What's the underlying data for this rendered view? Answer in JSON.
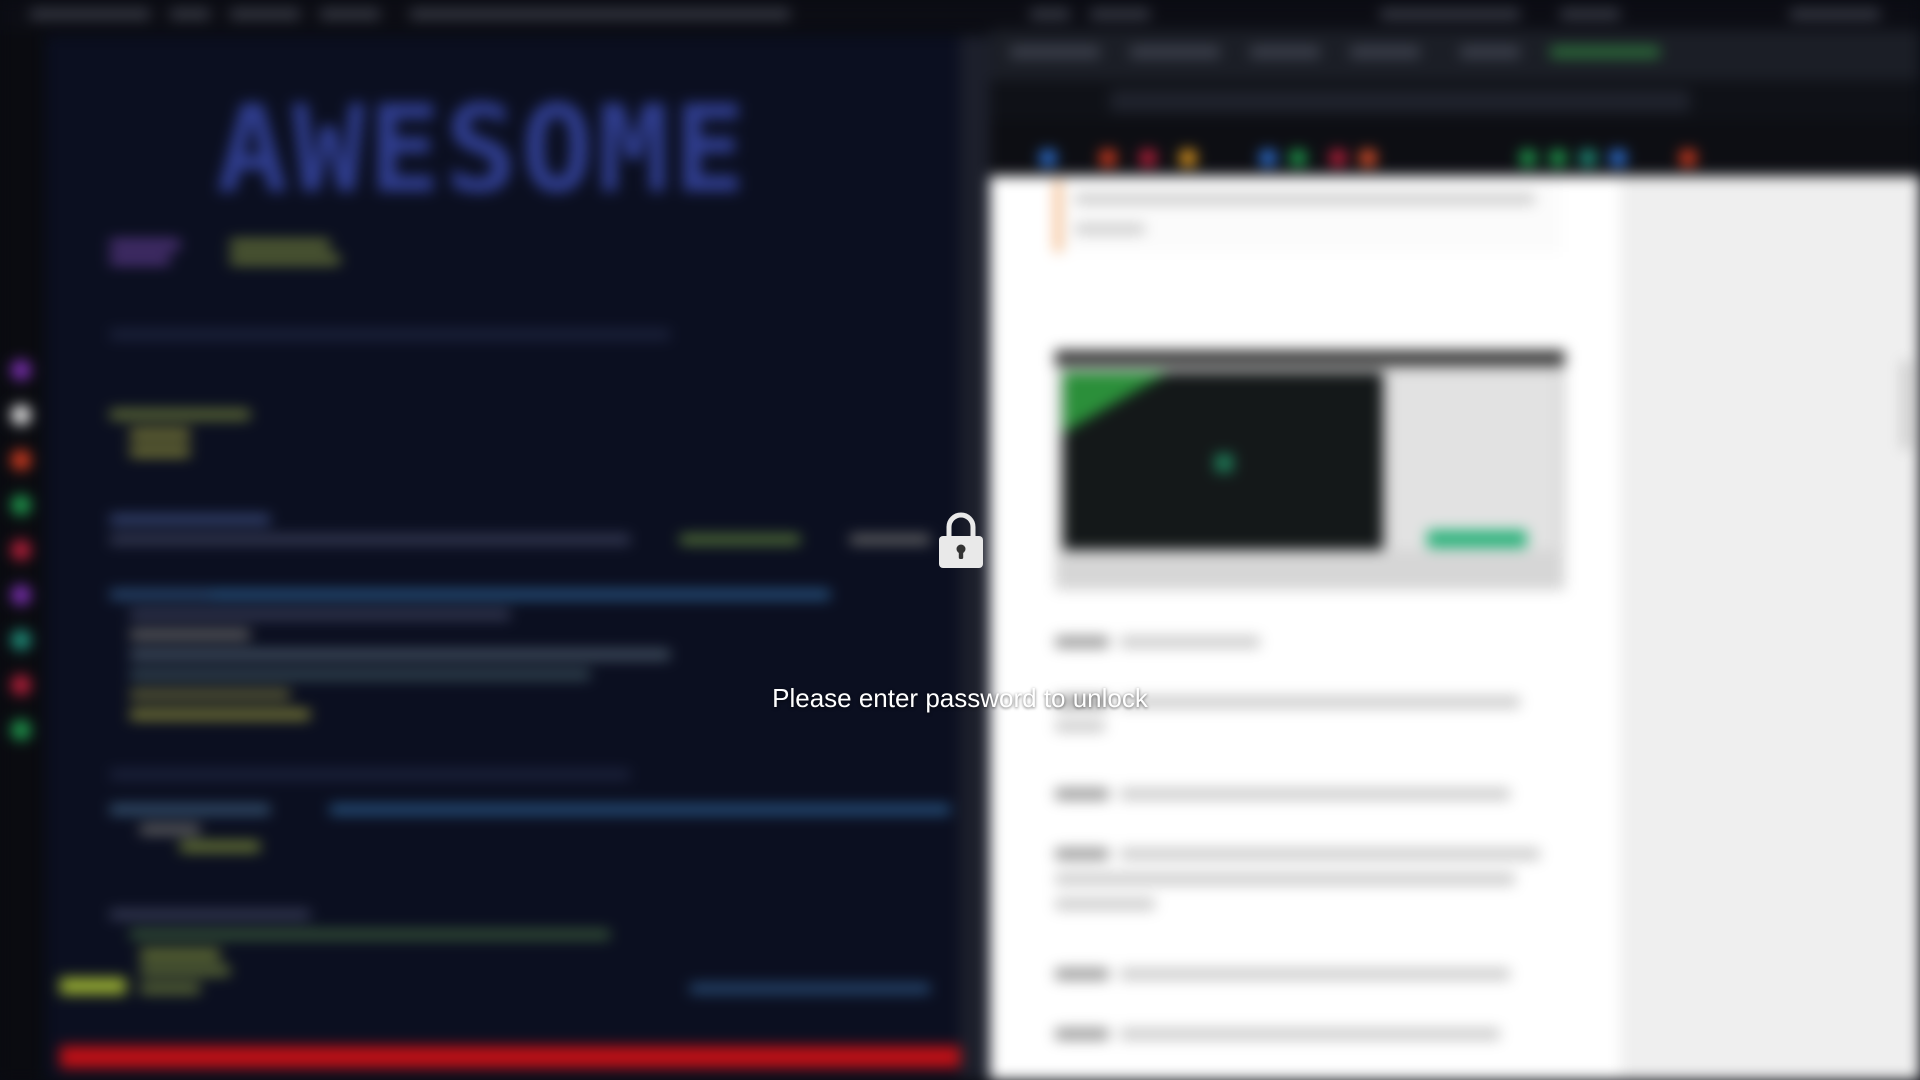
{
  "screen": "lock-screen",
  "lock": {
    "icon": "padlock-icon",
    "message": "Please enter password to unlock"
  },
  "background": {
    "left_app": {
      "type": "terminal",
      "banner": "AWESOME"
    },
    "right_app": {
      "type": "web-browser"
    }
  },
  "colors": {
    "terminal_bg": "#0b0f20",
    "banner": "#2f3d8e",
    "terminal_status": "#c11016",
    "browser_page": "#ffffff",
    "accent_note": "#f2a86a",
    "lock_text": "#ffffff"
  }
}
